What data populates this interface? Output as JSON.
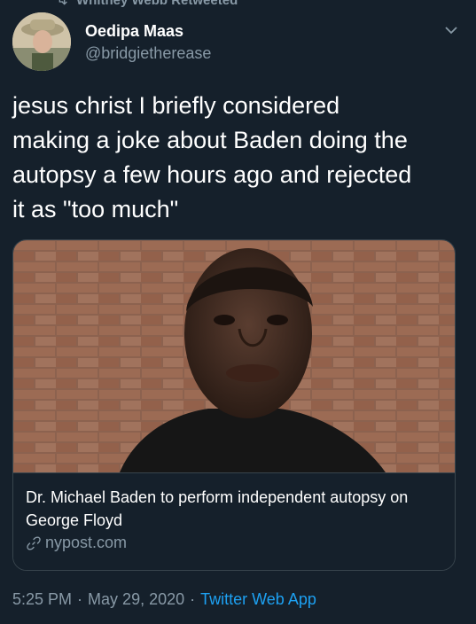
{
  "retweet": {
    "label": "Whitney Webb Retweeted"
  },
  "author": {
    "name": "Oedipa Maas",
    "handle": "@bridgietherease"
  },
  "tweet": {
    "text": "jesus christ I briefly considered\nmaking a joke about Baden doing the\nautopsy a few hours ago and rejected\nit as \"too much\""
  },
  "card": {
    "title": "Dr. Michael Baden to perform independent autopsy on George Floyd",
    "domain": "nypost.com"
  },
  "meta": {
    "time": "5:25 PM",
    "sep1": "·",
    "date": "May 29, 2020",
    "sep2": "·",
    "app": "Twitter Web App"
  },
  "colors": {
    "background": "#15202b",
    "secondary_text": "#8899a6",
    "accent": "#1da1f2",
    "border": "#38444d"
  },
  "icons": {
    "retweet": "retweet-icon",
    "chevron": "chevron-down-icon",
    "link": "link-icon"
  }
}
